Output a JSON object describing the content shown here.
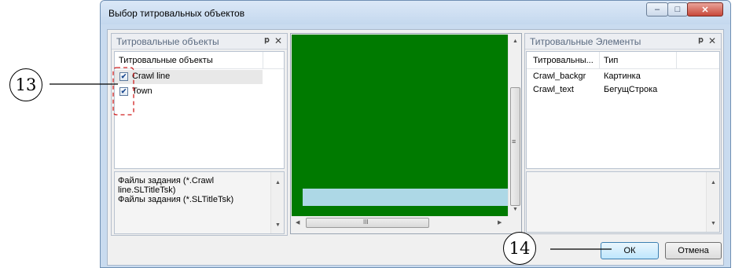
{
  "window": {
    "title": "Выбор титровальных объектов",
    "controls": [
      "minimize-icon",
      "maximize-icon",
      "close-icon"
    ]
  },
  "left_panel": {
    "header": "Титровальные объекты",
    "pin_glyph": "ᵖ",
    "column_header": "Титровальные объекты",
    "items": [
      {
        "label": "Crawl line",
        "checked": true,
        "selected": true
      },
      {
        "label": "Town",
        "checked": true,
        "selected": false
      }
    ],
    "files_text": "Файлы задания (*.Crawl line.SLTitleTsk)\nФайлы задания (*.SLTitleTsk)"
  },
  "preview": {
    "background_color": "#007a00",
    "bar_color": "#add8e6",
    "hscroll_mid": "III",
    "vscroll_mid": "≡"
  },
  "right_panel": {
    "header": "Титровальные Элементы",
    "columns": [
      "Титровальны...",
      "Тип"
    ],
    "rows": [
      [
        "Crawl_backgr",
        "Картинка"
      ],
      [
        "Crawl_text",
        "БегущСтрока"
      ]
    ]
  },
  "buttons": {
    "ok": "ОК",
    "cancel": "Отмена"
  },
  "callouts": {
    "left": "13",
    "bottom": "14"
  }
}
